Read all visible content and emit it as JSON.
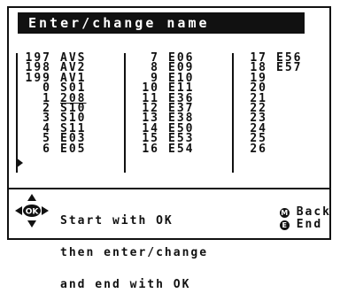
{
  "title": "Enter/change name",
  "columns": [
    [
      {
        "num": "197",
        "name": "AVS"
      },
      {
        "num": "198",
        "name": "AV2"
      },
      {
        "num": "199",
        "name": "AV1"
      },
      {
        "num": "0",
        "name": "S01"
      },
      {
        "num": "1",
        "name": "208"
      },
      {
        "num": "2",
        "name": "S10"
      },
      {
        "num": "3",
        "name": "S10"
      },
      {
        "num": "4",
        "name": "S11"
      },
      {
        "num": "5",
        "name": "E03"
      },
      {
        "num": "6",
        "name": "E05"
      }
    ],
    [
      {
        "num": "7",
        "name": "E06"
      },
      {
        "num": "8",
        "name": "E09"
      },
      {
        "num": "9",
        "name": "E10"
      },
      {
        "num": "10",
        "name": "E11"
      },
      {
        "num": "11",
        "name": "E36"
      },
      {
        "num": "12",
        "name": "E37"
      },
      {
        "num": "13",
        "name": "E38"
      },
      {
        "num": "14",
        "name": "E50"
      },
      {
        "num": "15",
        "name": "E53"
      },
      {
        "num": "16",
        "name": "E54"
      }
    ],
    [
      {
        "num": "17",
        "name": "E56"
      },
      {
        "num": "18",
        "name": "E57"
      },
      {
        "num": "19",
        "name": ""
      },
      {
        "num": "20",
        "name": ""
      },
      {
        "num": "21",
        "name": ""
      },
      {
        "num": "22",
        "name": ""
      },
      {
        "num": "23",
        "name": ""
      },
      {
        "num": "24",
        "name": ""
      },
      {
        "num": "25",
        "name": ""
      },
      {
        "num": "26",
        "name": ""
      }
    ]
  ],
  "selected": {
    "column": 0,
    "row": 4
  },
  "help": {
    "line1": "Start with OK",
    "line2": "then enter/change",
    "line3": "and end with OK"
  },
  "ok_icon": "ok-dpad-icon",
  "legend": [
    {
      "icon": "m-button-icon",
      "key": "M",
      "label": "Back"
    },
    {
      "icon": "e-button-icon",
      "key": "E",
      "label": "End"
    }
  ]
}
